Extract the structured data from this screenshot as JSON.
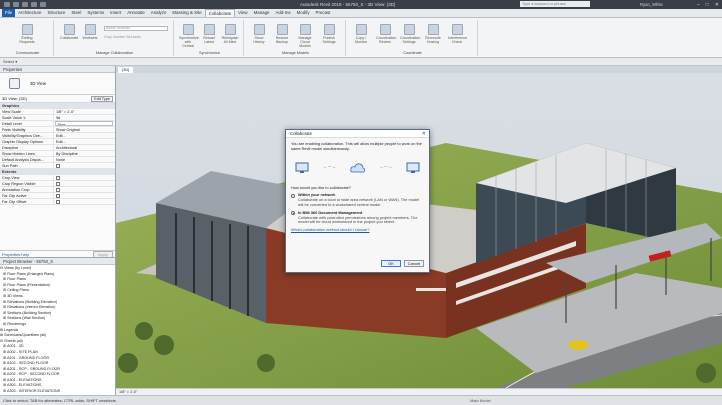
{
  "app": {
    "title": "Autodesk Revit 2018 - 56750_S - 3D View: {3D}",
    "search_placeholder": "Type a keyword or phrase",
    "user": "Ryan_White",
    "win_buttons": [
      "–",
      "□",
      "✕"
    ]
  },
  "tabs": [
    "File",
    "Architecture",
    "Structure",
    "Steel",
    "Systems",
    "Insert",
    "Annotate",
    "Analyze",
    "Massing & Site",
    "Collaborate",
    "View",
    "Manage",
    "Add-Ins",
    "Modify",
    "Precast"
  ],
  "active_tab": "Collaborate",
  "ribbon": {
    "groups": [
      {
        "label": "Communicate",
        "buttons": [
          "Editing Requests"
        ]
      },
      {
        "label": "Manage Collaboration",
        "buttons": [
          "Collaborate",
          "Worksets"
        ]
      },
      {
        "label": "Synchronize",
        "buttons": [
          "Synchronize with Central",
          "Reload Latest",
          "Relinquish All Mine"
        ]
      },
      {
        "label": "Manage Models",
        "buttons": [
          "Show History",
          "Restore Backup",
          "Manage Cloud Models",
          "Publish Settings"
        ]
      },
      {
        "label": "Coordinate",
        "buttons": [
          "Copy / Monitor",
          "Coordination Review",
          "Coordination Settings",
          "Reconcile Hosting",
          "Interference Check"
        ]
      }
    ],
    "active_workset_placeholder": "Active Workset",
    "gray_inactive_label": "Gray Inactive Worksets"
  },
  "options_bar": {
    "label": "Select ▾"
  },
  "properties": {
    "header": "Properties",
    "type_name": "3D View",
    "view_selector": "3D View: {3D}",
    "edit_type_label": "Edit Type",
    "group_graphics": "Graphics",
    "rows_graphics": [
      {
        "k": "View Scale",
        "v": "1/8\" = 1'-0\""
      },
      {
        "k": "Scale Value 1:",
        "v": "96"
      },
      {
        "k": "Detail Level",
        "v": "Fine"
      },
      {
        "k": "Parts Visibility",
        "v": "Show Original"
      },
      {
        "k": "Visibility/Graphics Ove...",
        "v": "Edit..."
      },
      {
        "k": "Graphic Display Options",
        "v": "Edit..."
      },
      {
        "k": "Discipline",
        "v": "Architectural"
      },
      {
        "k": "Show Hidden Lines",
        "v": "By Discipline"
      },
      {
        "k": "Default Analysis Displa...",
        "v": "None"
      },
      {
        "k": "Sun Path",
        "v": ""
      }
    ],
    "group_extents": "Extents",
    "rows_extents": [
      {
        "k": "Crop View",
        "v": ""
      },
      {
        "k": "Crop Region Visible",
        "v": ""
      },
      {
        "k": "Annotation Crop",
        "v": ""
      },
      {
        "k": "Far Clip Active",
        "v": ""
      },
      {
        "k": "Far Clip Offset",
        "v": ""
      }
    ],
    "help_link": "Properties help",
    "apply_label": "Apply"
  },
  "browser": {
    "header": "Project Browser - 56750_S",
    "items": [
      "⊟ Views (by Level)",
      "   ⊞ Floor Plans (Enlarged Plans)",
      "   ⊞ Floor Plans",
      "   ⊞ Floor Plans (Presentation)",
      "   ⊞ Ceiling Plans",
      "   ⊞ 3D Views",
      "   ⊞ Elevations (Building Elevation)",
      "   ⊞ Elevations (Interior Elevation)",
      "   ⊞ Sections (Building Section)",
      "   ⊞ Sections (Wall Section)",
      "   ⊞ Renderings",
      "⊞ Legends",
      "⊞ Schedules/Quantities (all)",
      "⊟ Sheets (all)",
      "   ⊞ A001 - 3D",
      "   ⊞ A002 - SITE PLAN",
      "   ⊞ A101 - GROUND FLOOR",
      "   ⊞ A102 - SECOND FLOOR",
      "   ⊞ A201 - RCP - GROUND FLOOR",
      "   ⊞ A202 - RCP - SECOND FLOOR",
      "   ⊞ A301 - ELEVATIONS",
      "   ⊞ A302 - ELEVATIONS",
      "   ⊞ A303 - INTERIOR ELEVATIONS"
    ]
  },
  "view_tabs": [
    "{3D}"
  ],
  "view_control": "1/8\" = 1'-0\"",
  "status": {
    "left": "Click to select, TAB for alternates, CTRL adds, SHIFT unselects.",
    "model": "Main Model"
  },
  "dialog": {
    "title": "Collaborate",
    "close": "✕",
    "intro": "You are enabling collaboration. This will allow multiple people to work on the same Revit model simultaneously.",
    "arrow": "←···→",
    "question": "How would you like to collaborate?",
    "options": [
      {
        "title": "Within your network",
        "desc": "Collaborate on a local or wide area network (LAN or WAN). The model will be converted to a workshared central model.",
        "selected": false
      },
      {
        "title": "In BIM 360 Document Management",
        "desc": "Collaborate with controlled permissions among project members. The model will be cloud workshared in the project you select.",
        "selected": true
      }
    ],
    "link": "Which collaboration method should I choose?",
    "ok": "OK",
    "cancel": "Cancel"
  }
}
